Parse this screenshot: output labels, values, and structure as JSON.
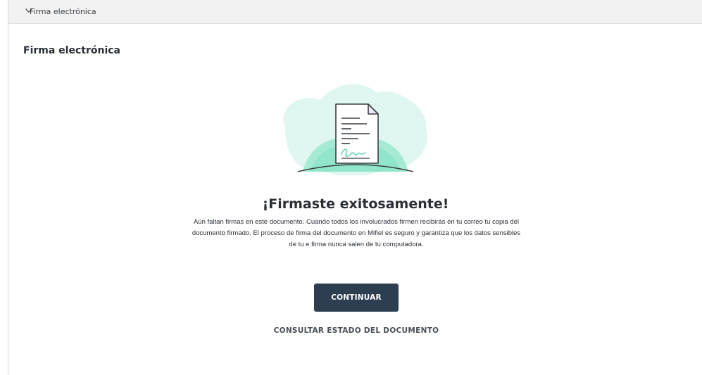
{
  "accordion": {
    "title": "Firma electrónica",
    "icon": "chevron-down-icon"
  },
  "section": {
    "title": "Firma electrónica"
  },
  "illustration": {
    "icon": "signed-document-icon",
    "blob_color": "#dff7f0",
    "accent_color": "#5fd3b5"
  },
  "success": {
    "title": "¡Firmaste exitosamente!",
    "body": "Aún faltan firmas en este documento. Cuando todos los involucrados firmen recibirás en tu correo tu copia del documento firmado. El proceso de firma del documento en Mifiel es seguro y garantiza que los datos sensibles de tu e.firma nunca salen de tu computadora."
  },
  "actions": {
    "continue_label": "CONTINUAR",
    "status_link_label": "CONSULTAR ESTADO DEL DOCUMENTO"
  },
  "colors": {
    "button_bg": "#2c3e50",
    "header_bg": "#f2f2f2"
  }
}
